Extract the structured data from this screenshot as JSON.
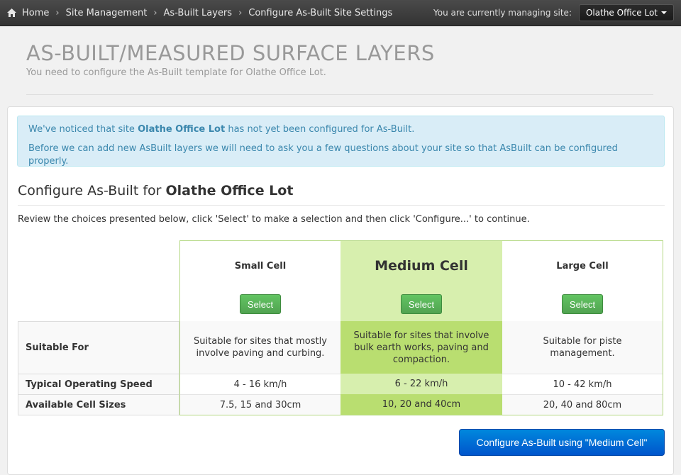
{
  "breadcrumb": {
    "home": "Home",
    "items": [
      "Site Management",
      "As-Built Layers",
      "Configure As-Built Site Settings"
    ]
  },
  "site_selector": {
    "label": "You are currently managing site:",
    "current": "Olathe Office Lot"
  },
  "header": {
    "title": "AS-BUILT/MEASURED SURFACE LAYERS",
    "subtitle": "You need to configure the As-Built template for Olathe Office Lot."
  },
  "alert": {
    "line1_prefix": "We've noticed that site ",
    "line1_site": "Olathe Office Lot",
    "line1_suffix": " has not yet been configured for As-Built.",
    "line2": "Before we can add new AsBuilt layers we will need to ask you a few questions about your site so that AsBuilt can be configured properly."
  },
  "configure": {
    "title_prefix": "Configure As-Built for ",
    "title_site": "Olathe Office Lot",
    "instructions": "Review the choices presented below, click 'Select' to make a selection and then click 'Configure...' to continue."
  },
  "options": [
    {
      "name": "Small Cell",
      "select_label": "Select",
      "suitable_for": "Suitable for sites that mostly involve paving and curbing.",
      "speed": "4 - 16 km/h",
      "cell_sizes": "7.5, 15 and 30cm"
    },
    {
      "name": "Medium Cell",
      "select_label": "Select",
      "suitable_for": "Suitable for sites that involve bulk earth works, paving and compaction.",
      "speed": "6 - 22 km/h",
      "cell_sizes": "10, 20 and 40cm"
    },
    {
      "name": "Large Cell",
      "select_label": "Select",
      "suitable_for": "Suitable for piste management.",
      "speed": "10 - 42 km/h",
      "cell_sizes": "20, 40 and 80cm"
    }
  ],
  "row_labels": {
    "suitable_for": "Suitable For",
    "speed": "Typical Operating Speed",
    "cell_sizes": "Available Cell Sizes"
  },
  "selected_option": "Medium Cell",
  "configure_button": "Configure As-Built using \"Medium Cell\"",
  "colors": {
    "selected_header": "#d7efae",
    "selected_body": "#b9de70",
    "selected_speed": "#d7efae",
    "alert_bg": "#d9edf7",
    "alert_text": "#3a87ad",
    "select_button": "#5bb75b",
    "primary_button": "#006dcc"
  }
}
